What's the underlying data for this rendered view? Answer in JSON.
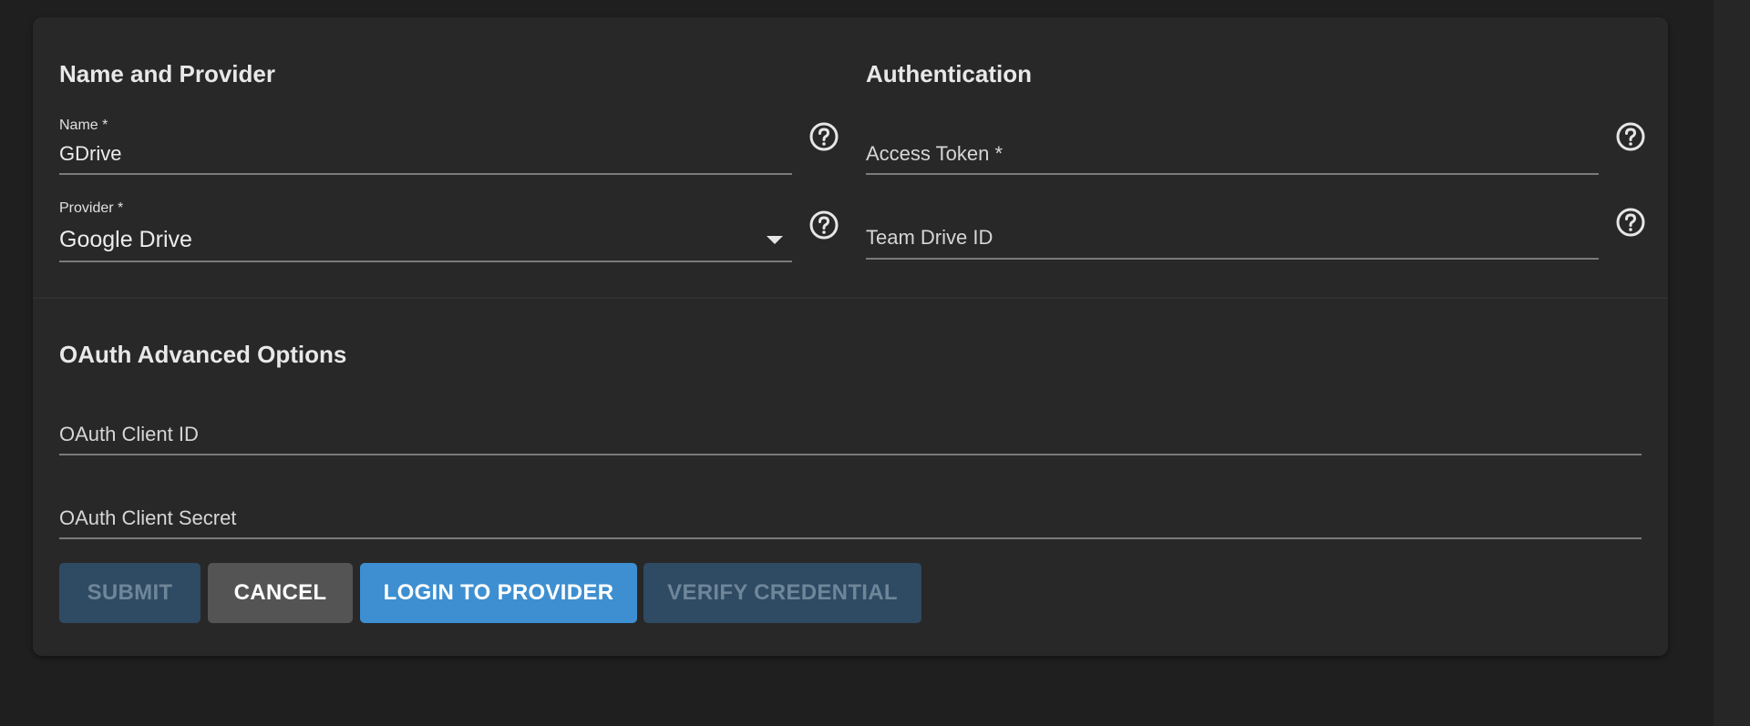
{
  "colors": {
    "background": "#1f1f1f",
    "card": "#282828",
    "primary": "#3d8fd1",
    "disabled_button": "#2f4a63",
    "cancel_button": "#545454"
  },
  "sections": {
    "name_provider": "Name and Provider",
    "authentication": "Authentication",
    "oauth_advanced": "OAuth Advanced Options"
  },
  "fields": {
    "name": {
      "label": "Name *",
      "value": "GDrive"
    },
    "provider": {
      "label": "Provider *",
      "value": "Google Drive"
    },
    "access_token": {
      "placeholder": "Access Token *"
    },
    "team_drive_id": {
      "placeholder": "Team Drive ID"
    },
    "oauth_client_id": {
      "placeholder": "OAuth Client ID"
    },
    "oauth_client_secret": {
      "placeholder": "OAuth Client Secret"
    }
  },
  "buttons": {
    "submit": "SUBMIT",
    "cancel": "CANCEL",
    "login": "LOGIN TO PROVIDER",
    "verify": "VERIFY CREDENTIAL"
  },
  "icons": {
    "help": "help-circle-icon",
    "dropdown": "caret-down-icon"
  }
}
